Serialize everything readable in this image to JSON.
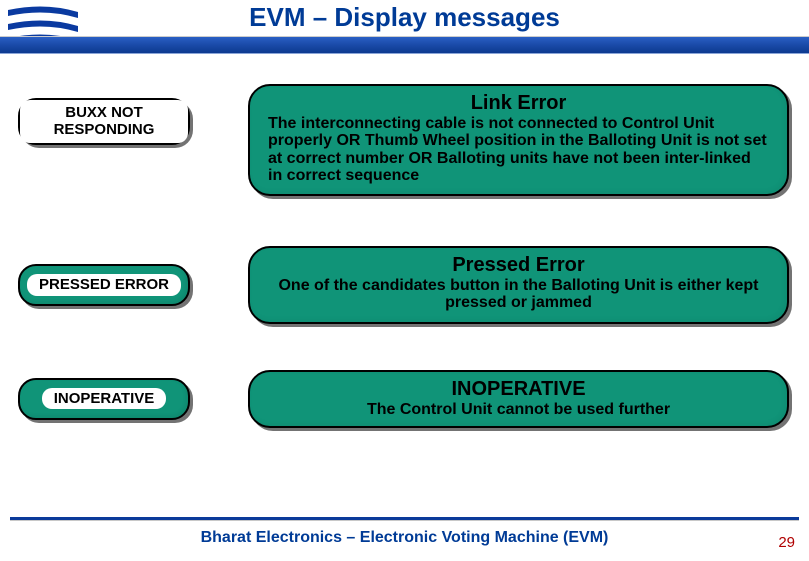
{
  "header": {
    "title": "EVM – Display messages"
  },
  "rows": [
    {
      "label": "BUXX NOT RESPONDING",
      "title": "Link Error",
      "body": "The interconnecting cable is  not connected to Control Unit  properly OR Thumb Wheel position in the Balloting Unit is not set at correct number OR Balloting units have not been inter-linked in correct sequence"
    },
    {
      "label": "PRESSED ERROR",
      "title": "Pressed Error",
      "body": "One of the candidates button  in the Balloting Unit is either kept pressed or jammed"
    },
    {
      "label": "INOPERATIVE",
      "title": "INOPERATIVE",
      "body": "The Control Unit cannot be used further"
    }
  ],
  "footer": {
    "text": "Bharat Electronics – Electronic Voting Machine (EVM)",
    "page": "29"
  }
}
